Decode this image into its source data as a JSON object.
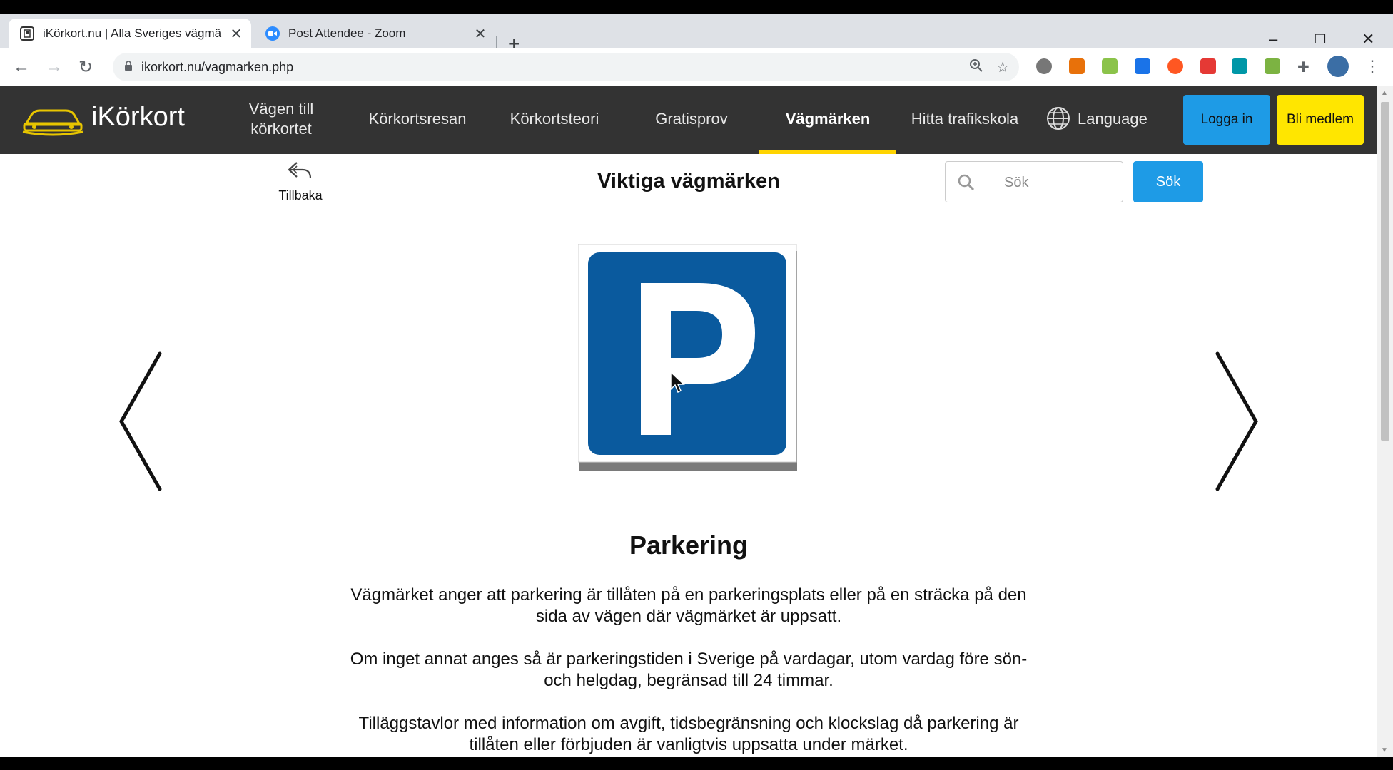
{
  "browser": {
    "tabs": [
      {
        "title": "iKörkort.nu | Alla Sveriges vägmä",
        "active": true,
        "favicon": "ikorkort-favicon"
      },
      {
        "title": "Post Attendee - Zoom",
        "active": false,
        "favicon": "zoom-icon"
      }
    ],
    "url": "ikorkort.nu/vagmarken.php",
    "window_controls": {
      "minimize": "–",
      "restore": "❐",
      "close": "✕"
    }
  },
  "site": {
    "logo_text": "iKörkort",
    "nav": [
      {
        "label": "Vägen till körkortet"
      },
      {
        "label": "Körkortsresan"
      },
      {
        "label": "Körkortsteori"
      },
      {
        "label": "Gratisprov"
      },
      {
        "label": "Vägmärken",
        "active": true
      },
      {
        "label": "Hitta trafikskola"
      },
      {
        "label": "Language"
      }
    ],
    "login_label": "Logga in",
    "member_label": "Bli medlem",
    "colors": {
      "nav_bg": "#333333",
      "accent_yellow": "#ffd400",
      "accent_blue": "#1e9be6",
      "sign_blue": "#0a5a9e"
    }
  },
  "page": {
    "back_label": "Tillbaka",
    "title": "Viktiga vägmärken",
    "search": {
      "placeholder": "Sök",
      "button_label": "Sök"
    },
    "sign": {
      "letter": "P",
      "name": "Parkering",
      "paragraphs": [
        "Vägmärket anger att parkering är tillåten på en parkeringsplats eller på en sträcka på den sida av vägen där vägmärket är uppsatt.",
        "Om inget annat anges så är parkeringstiden i Sverige på vardagar, utom vardag före sön- och helgdag, begränsad till 24 timmar.",
        "Tilläggstavlor med information om avgift, tidsbegränsning och klockslag då parkering är tillåten eller förbjuden är vanligtvis uppsatta under märket."
      ]
    }
  }
}
